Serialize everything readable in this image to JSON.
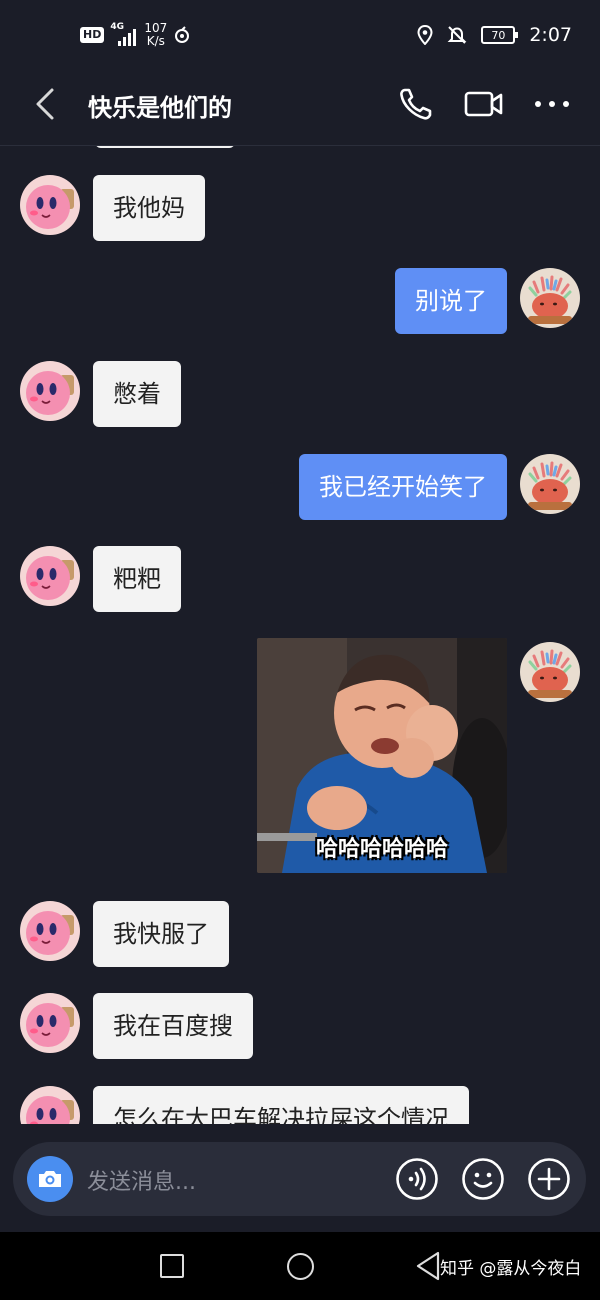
{
  "status_bar": {
    "hd": "HD",
    "network": "4G",
    "speed_value": "107",
    "speed_unit": "K/s",
    "battery": "70",
    "time": "2:07"
  },
  "header": {
    "title": "快乐是他们的"
  },
  "messages": [
    {
      "side": "in",
      "text": "我他妈"
    },
    {
      "side": "out",
      "text": "别说了"
    },
    {
      "side": "in",
      "text": "憋着"
    },
    {
      "side": "out",
      "text": "我已经开始笑了"
    },
    {
      "side": "in",
      "text": "粑粑"
    },
    {
      "side": "out",
      "type": "image",
      "caption": "哈哈哈哈哈哈"
    },
    {
      "side": "in",
      "text": "我快服了"
    },
    {
      "side": "in",
      "text": "我在百度搜"
    },
    {
      "side": "in",
      "text": "怎么在大巴车解决拉屎这个情况"
    }
  ],
  "input": {
    "placeholder": "发送消息..."
  },
  "watermark": "知乎 @露从今夜白",
  "colors": {
    "background": "#1b1d28",
    "incoming_bubble": "#f3f3f3",
    "outgoing_bubble": "#5f8ff5",
    "input_bar": "#2a2d3a",
    "camera_button": "#4a8ef0"
  }
}
